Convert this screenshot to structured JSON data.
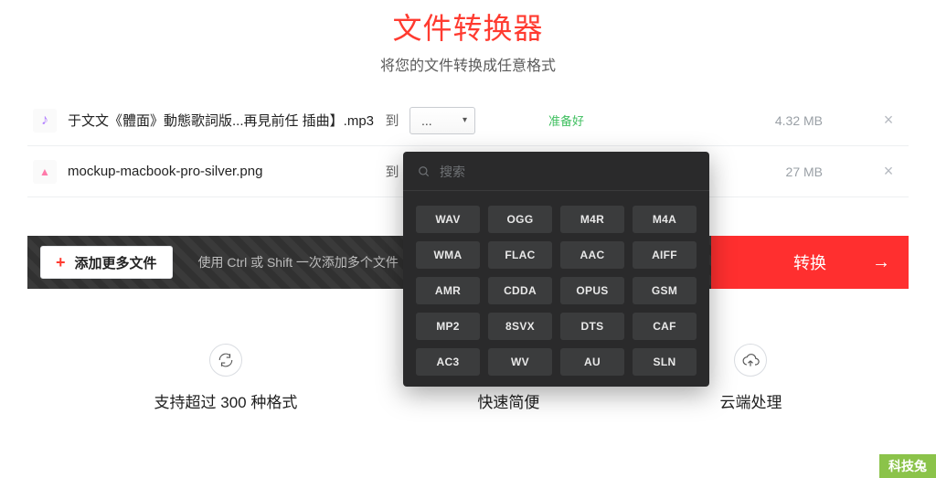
{
  "header": {
    "title": "文件转换器",
    "subtitle": "将您的文件转换成任意格式"
  },
  "files": [
    {
      "name": "于文文《體面》動態歌詞版...再見前任 插曲】.mp3",
      "to_label": "到",
      "format_value": "...",
      "status": "准备好",
      "size": "4.32 MB",
      "icon": "music"
    },
    {
      "name": "mockup-macbook-pro-silver.png",
      "to_label": "到",
      "format_value": "...",
      "status": "",
      "size": "27 MB",
      "icon": "image"
    }
  ],
  "actions": {
    "add_label": "添加更多文件",
    "hint": "使用 Ctrl 或 Shift 一次添加多个文件",
    "convert_label": "转换"
  },
  "dropdown": {
    "search_placeholder": "搜索",
    "items": [
      "WAV",
      "OGG",
      "M4R",
      "M4A",
      "WMA",
      "FLAC",
      "AAC",
      "AIFF",
      "AMR",
      "CDDA",
      "OPUS",
      "GSM",
      "MP2",
      "8SVX",
      "DTS",
      "CAF",
      "AC3",
      "WV",
      "AU",
      "SLN"
    ]
  },
  "features": [
    {
      "title": "支持超过 300 种格式",
      "icon": "refresh"
    },
    {
      "title": "快速简便",
      "icon": "star"
    },
    {
      "title": "云端处理",
      "icon": "cloud"
    }
  ],
  "badge": "科技兔"
}
